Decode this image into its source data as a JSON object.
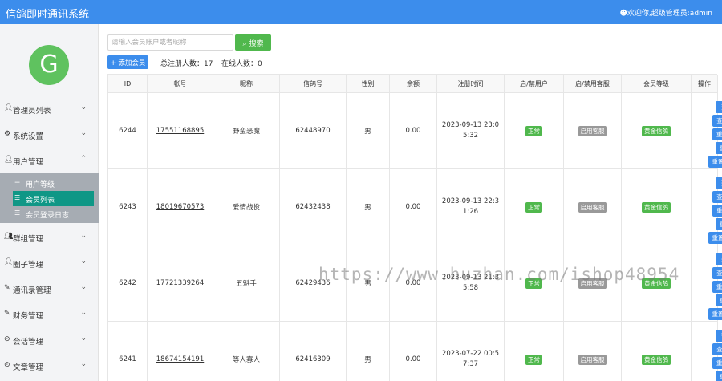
{
  "header": {
    "title": "信鸽即时通讯系统",
    "welcome": "欢迎你,超级管理员:admin"
  },
  "sidebar": {
    "logo_letter": "G",
    "items": [
      {
        "label": "管理员列表",
        "icon": "user-icon"
      },
      {
        "label": "系统设置",
        "icon": "gear-icon"
      },
      {
        "label": "用户管理",
        "icon": "user-icon"
      },
      {
        "label": "群组管理",
        "icon": "users-icon"
      },
      {
        "label": "圈子管理",
        "icon": "user-icon"
      },
      {
        "label": "通讯录管理",
        "icon": "edit-icon"
      },
      {
        "label": "财务管理",
        "icon": "edit-icon"
      },
      {
        "label": "会话管理",
        "icon": "pin-icon"
      },
      {
        "label": "文章管理",
        "icon": "pin-icon"
      }
    ],
    "sub_items": [
      {
        "label": "用户等级",
        "icon": "list-icon"
      },
      {
        "label": "会员列表",
        "icon": "list-icon"
      },
      {
        "label": "会员登录日志",
        "icon": "list-icon"
      }
    ]
  },
  "search": {
    "placeholder": "请输入会员账户或者昵称",
    "button": "搜索"
  },
  "add_button": "添加会员",
  "stats": {
    "total": "总注册人数：17",
    "online": "在线人数：0"
  },
  "table": {
    "headers": [
      "ID",
      "帐号",
      "昵称",
      "信鸽号",
      "性别",
      "余额",
      "注册时间",
      "启/禁用户",
      "启/禁用客服",
      "会员等级",
      "操作"
    ],
    "rows": [
      {
        "id": "6244",
        "account": "17551168895",
        "nickname": "野蛮恶魔",
        "pigeon_no": "62448970",
        "gender": "男",
        "balance": "0.00",
        "reg_time": "2023-09-13 23:05:32",
        "status": "正常",
        "cs_status": "启用客服",
        "level": "黄金信鸽"
      },
      {
        "id": "6243",
        "account": "18019670573",
        "nickname": "爱情战役",
        "pigeon_no": "62432438",
        "gender": "男",
        "balance": "0.00",
        "reg_time": "2023-09-13 22:31:26",
        "status": "正常",
        "cs_status": "启用客服",
        "level": "黄金信鸽"
      },
      {
        "id": "6242",
        "account": "17721339264",
        "nickname": "五魁手",
        "pigeon_no": "62429436",
        "gender": "男",
        "balance": "0.00",
        "reg_time": "2023-09-13 21:35:58",
        "status": "正常",
        "cs_status": "启用客服",
        "level": "黄金信鸽"
      },
      {
        "id": "6241",
        "account": "18674154191",
        "nickname": "等人寡人",
        "pigeon_no": "62416309",
        "gender": "男",
        "balance": "0.00",
        "reg_time": "2023-07-22 00:57:37",
        "status": "正常",
        "cs_status": "启用客服",
        "level": "黄金信鸽"
      }
    ],
    "actions": [
      "查看会话",
      "查看通讯录",
      "重置信鸽ID",
      "重置密码",
      "重置交易密码"
    ]
  },
  "watermark": "https://www.huzhan.com/ishop48954"
}
